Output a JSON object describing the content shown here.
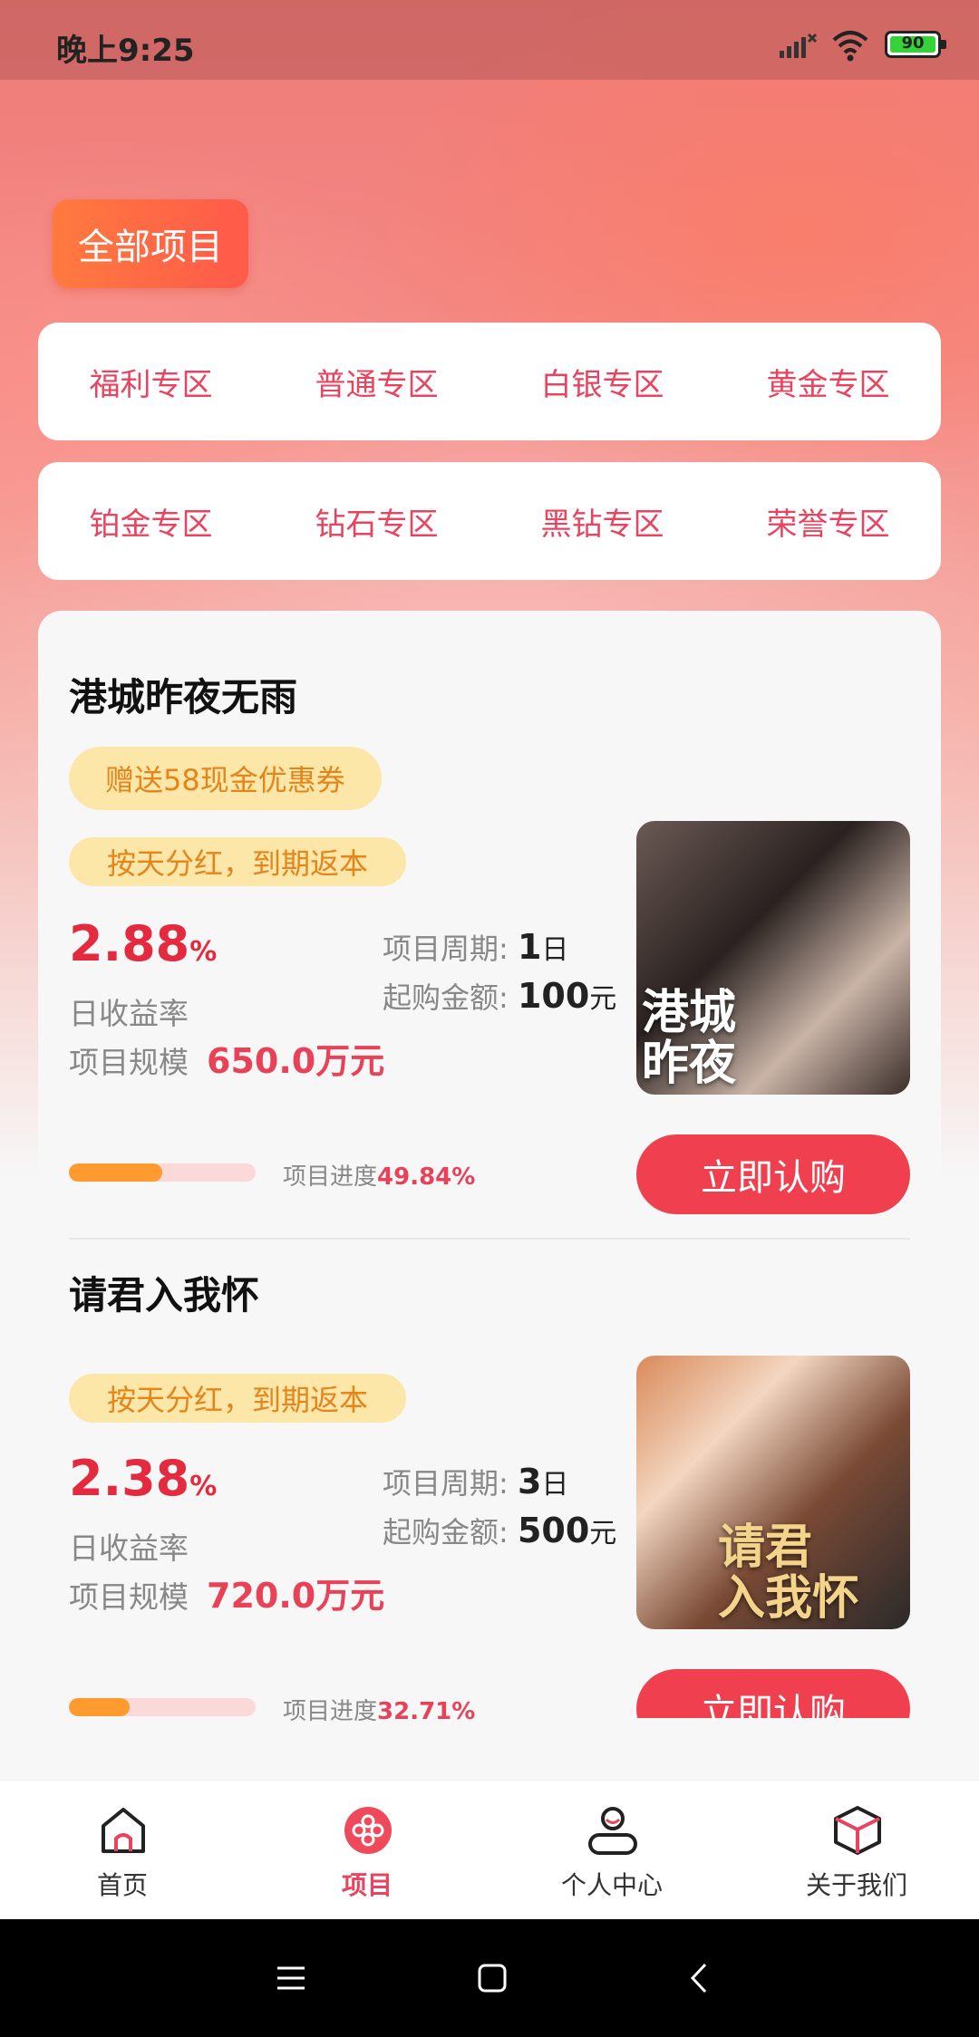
{
  "status_bar": {
    "time": "晚上9:25",
    "battery": "90"
  },
  "header": {
    "all_projects_label": "全部项目"
  },
  "zones": {
    "row1": [
      "福利专区",
      "普通专区",
      "白银专区",
      "黄金专区"
    ],
    "row2": [
      "铂金专区",
      "钻石专区",
      "黑钻专区",
      "荣誉专区"
    ]
  },
  "projects": [
    {
      "title": "港城昨夜无雨",
      "coupon": "赠送58现金优惠券",
      "tag": "按天分红，到期返本",
      "rate": "2.88",
      "rate_unit": "%",
      "rate_label": "日收益率",
      "scale_label": "项目规模",
      "scale_value": "650.0万元",
      "period_label": "项目周期:",
      "period_value": "1",
      "period_unit": "日",
      "min_label": "起购金额:",
      "min_value": "100",
      "min_unit": "元",
      "poster_text": "港城\n昨夜",
      "progress_label": "项目进度",
      "progress_value": "49.84%",
      "progress": 0.4984,
      "buy_label": "立即认购"
    },
    {
      "title": "请君入我怀",
      "tag": "按天分红，到期返本",
      "rate": "2.38",
      "rate_unit": "%",
      "rate_label": "日收益率",
      "scale_label": "项目规模",
      "scale_value": "720.0万元",
      "period_label": "项目周期:",
      "period_value": "3",
      "period_unit": "日",
      "min_label": "起购金额:",
      "min_value": "500",
      "min_unit": "元",
      "poster_text": "请君\n入我怀",
      "progress_label": "项目进度",
      "progress_value": "32.71%",
      "progress": 0.3271,
      "buy_label": "立即认购"
    }
  ],
  "nav": {
    "home": "首页",
    "projects": "项目",
    "profile": "个人中心",
    "about": "关于我们"
  },
  "colors": {
    "accent": "#e8445f",
    "button": "#f0404f",
    "tag_bg": "#fde7a8",
    "progress_fill": "#ff9a2e"
  }
}
